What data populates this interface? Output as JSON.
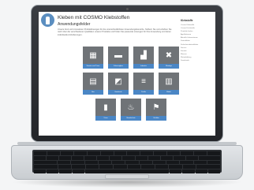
{
  "page": {
    "title": "Kleben mit COSMO Klebstoffen",
    "subtitle": "Anwendungsfelder",
    "paragraph": "Unsere breit und innovativen Produktlösungen für die unterschiedlichsten Anwendungsbereiche. Stöbern Sie und erfahren Sie mehr über die verschiedenen Qualitäten unserer Produkte und finden Sie passende Lösungen für Ihre Anwendung und deren individuelle Anforderungen."
  },
  "tiles": [
    {
      "label": "Fenster und Türen",
      "icon": "window-icon",
      "glyph": "▦"
    },
    {
      "label": "Fahrzeugbau",
      "icon": "truck-icon",
      "glyph": "▬"
    },
    {
      "label": "Industrie",
      "icon": "factory-icon",
      "glyph": "▟"
    },
    {
      "label": "Montage",
      "icon": "tools-icon",
      "glyph": "✖"
    },
    {
      "label": "Bau",
      "icon": "bricks-icon",
      "glyph": "▤"
    },
    {
      "label": "Handwerk",
      "icon": "panel-icon",
      "glyph": "◩"
    },
    {
      "label": "Profile",
      "icon": "pipes-icon",
      "glyph": "≡"
    },
    {
      "label": "Möbel",
      "icon": "radiator-icon",
      "glyph": "▥"
    },
    {
      "label": "Türen",
      "icon": "door-icon",
      "glyph": "▮"
    },
    {
      "label": "Brandschutz",
      "icon": "flame-icon",
      "glyph": "♨"
    },
    {
      "label": "Schilder",
      "icon": "signpost-icon",
      "glyph": "⚑"
    }
  ],
  "sidebar": {
    "title": "Klebstoffe",
    "items": [
      "Cosmo Klebstoffe",
      "Cosmo Dichtstoffe",
      "Produkte finden",
      "Applikationen",
      "Aktuelle Informationen",
      "Datenblätter",
      "Sicherheitsdatenblätter",
      "Service",
      "Kontakt",
      "Messen",
      "Weiterbildung",
      "Downloads"
    ]
  }
}
